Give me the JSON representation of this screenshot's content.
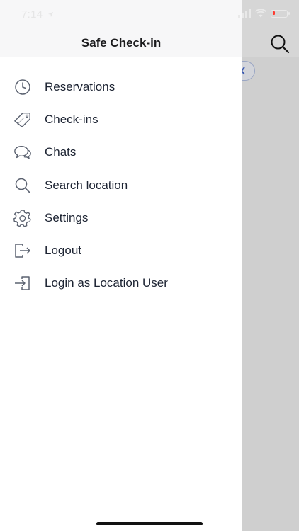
{
  "status_bar": {
    "time": "7:14",
    "location_arrow": "location-arrow-icon"
  },
  "drawer": {
    "title": "Safe Check-in",
    "items": [
      {
        "label": "Reservations",
        "icon": "clock-icon"
      },
      {
        "label": "Check-ins",
        "icon": "tag-icon"
      },
      {
        "label": "Chats",
        "icon": "chat-bubbles-icon"
      },
      {
        "label": "Search location",
        "icon": "search-icon"
      },
      {
        "label": "Settings",
        "icon": "gear-icon"
      },
      {
        "label": "Logout",
        "icon": "logout-icon"
      },
      {
        "label": "Login as Location User",
        "icon": "login-icon"
      }
    ]
  },
  "colors": {
    "icon_gray": "#5b6270",
    "text": "#1d2433",
    "overlay": "#cfcfcf",
    "battery_low": "#ff3b30"
  }
}
